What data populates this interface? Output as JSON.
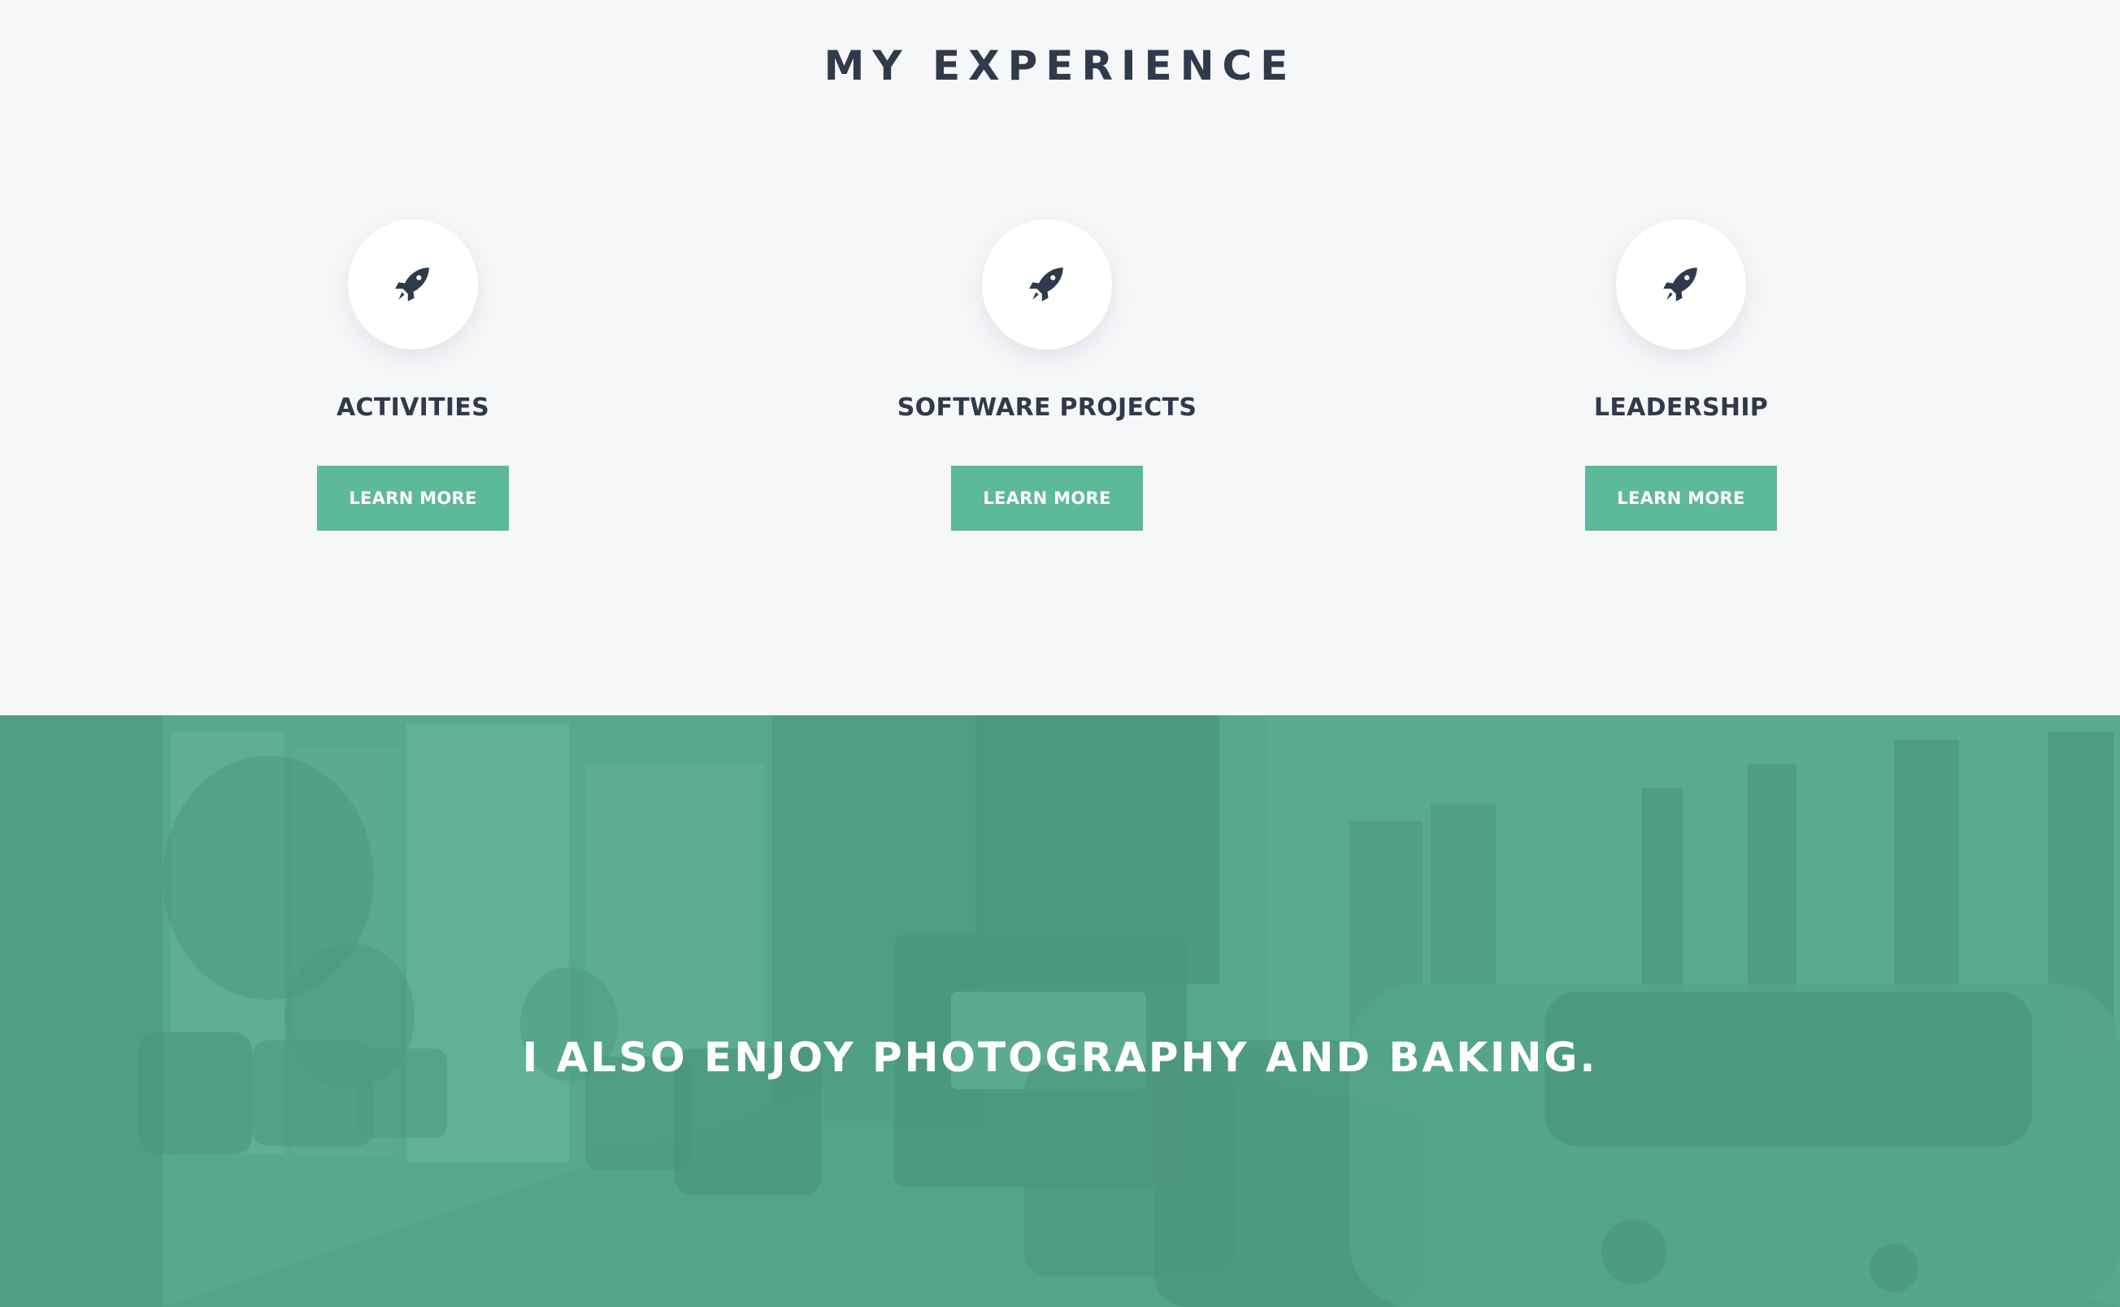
{
  "experience": {
    "title": "MY EXPERIENCE",
    "cards": [
      {
        "title": "ACTIVITIES",
        "button_label": "LEARN MORE",
        "icon": "rocket-icon"
      },
      {
        "title": "SOFTWARE PROJECTS",
        "button_label": "LEARN MORE",
        "icon": "rocket-icon"
      },
      {
        "title": "LEADERSHIP",
        "button_label": "LEARN MORE",
        "icon": "rocket-icon"
      }
    ]
  },
  "banner": {
    "text": "I ALSO ENJOY PHOTOGRAPHY AND BAKING."
  },
  "colors": {
    "accent": "#5cb99a",
    "heading": "#2f3a4b",
    "page_background": "#f6f7f9",
    "banner_overlay": "#56a98c"
  }
}
